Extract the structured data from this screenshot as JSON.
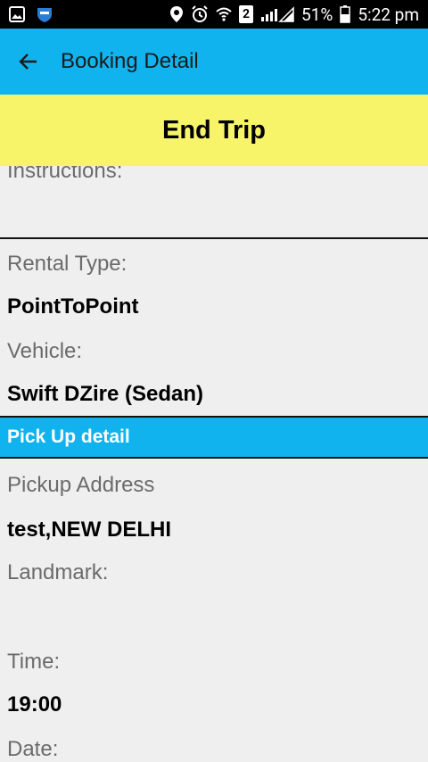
{
  "status_bar": {
    "battery_percent": "51%",
    "time": "5:22 pm",
    "sim_slot": "2"
  },
  "app_bar": {
    "title": "Booking Detail",
    "back_icon": "arrow-back-icon"
  },
  "end_trip_button": {
    "label": "End Trip"
  },
  "details": {
    "instructions_label": "Instructions:",
    "rental_type_label": "Rental Type:",
    "rental_type_value": "PointToPoint",
    "vehicle_label": "Vehicle:",
    "vehicle_value": "Swift DZire (Sedan)"
  },
  "pickup": {
    "section_title": "Pick Up detail",
    "address_label": "Pickup Address",
    "address_value": "test,NEW DELHI",
    "landmark_label": "Landmark:",
    "time_label": "Time:",
    "time_value": "19:00",
    "date_label": "Date:"
  },
  "colors": {
    "accent_blue": "#11b3ee",
    "end_trip_yellow": "#f7f46a",
    "background": "#efefef"
  }
}
